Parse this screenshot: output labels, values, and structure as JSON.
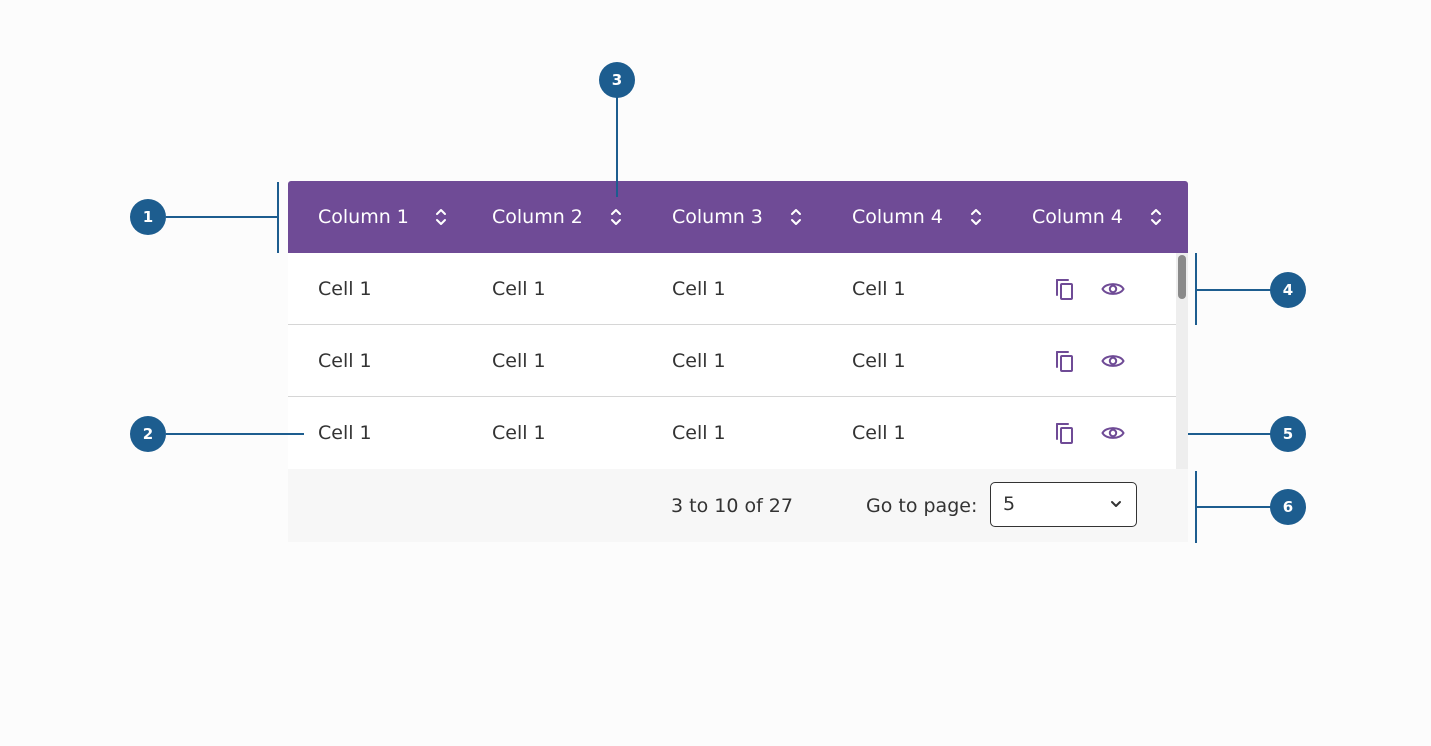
{
  "table": {
    "columns": [
      {
        "label": "Column 1",
        "sort_icon": "sort-icon"
      },
      {
        "label": "Column 2",
        "sort_icon": "sort-icon"
      },
      {
        "label": "Column 3",
        "sort_icon": "sort-icon"
      },
      {
        "label": "Column 4",
        "sort_icon": "sort-icon"
      },
      {
        "label": "Column 4",
        "sort_icon": "sort-icon"
      }
    ],
    "rows": [
      {
        "cells": [
          "Cell 1",
          "Cell 1",
          "Cell 1",
          "Cell 1"
        ],
        "actions": [
          "copy-icon",
          "eye-icon"
        ]
      },
      {
        "cells": [
          "Cell 1",
          "Cell 1",
          "Cell 1",
          "Cell 1"
        ],
        "actions": [
          "copy-icon",
          "eye-icon"
        ]
      },
      {
        "cells": [
          "Cell 1",
          "Cell 1",
          "Cell 1",
          "Cell 1"
        ],
        "actions": [
          "copy-icon",
          "eye-icon"
        ]
      }
    ]
  },
  "pagination": {
    "range_text": "3 to 10 of 27",
    "goto_label": "Go to page:",
    "selected_page": "5"
  },
  "callouts": [
    "1",
    "2",
    "3",
    "4",
    "5",
    "6"
  ],
  "colors": {
    "header_bg": "#6f4b96",
    "callout": "#1d5d8f",
    "action_icon": "#6f4b96",
    "footer_bg": "#f7f7f7",
    "page_bg": "#fcfcfc"
  }
}
